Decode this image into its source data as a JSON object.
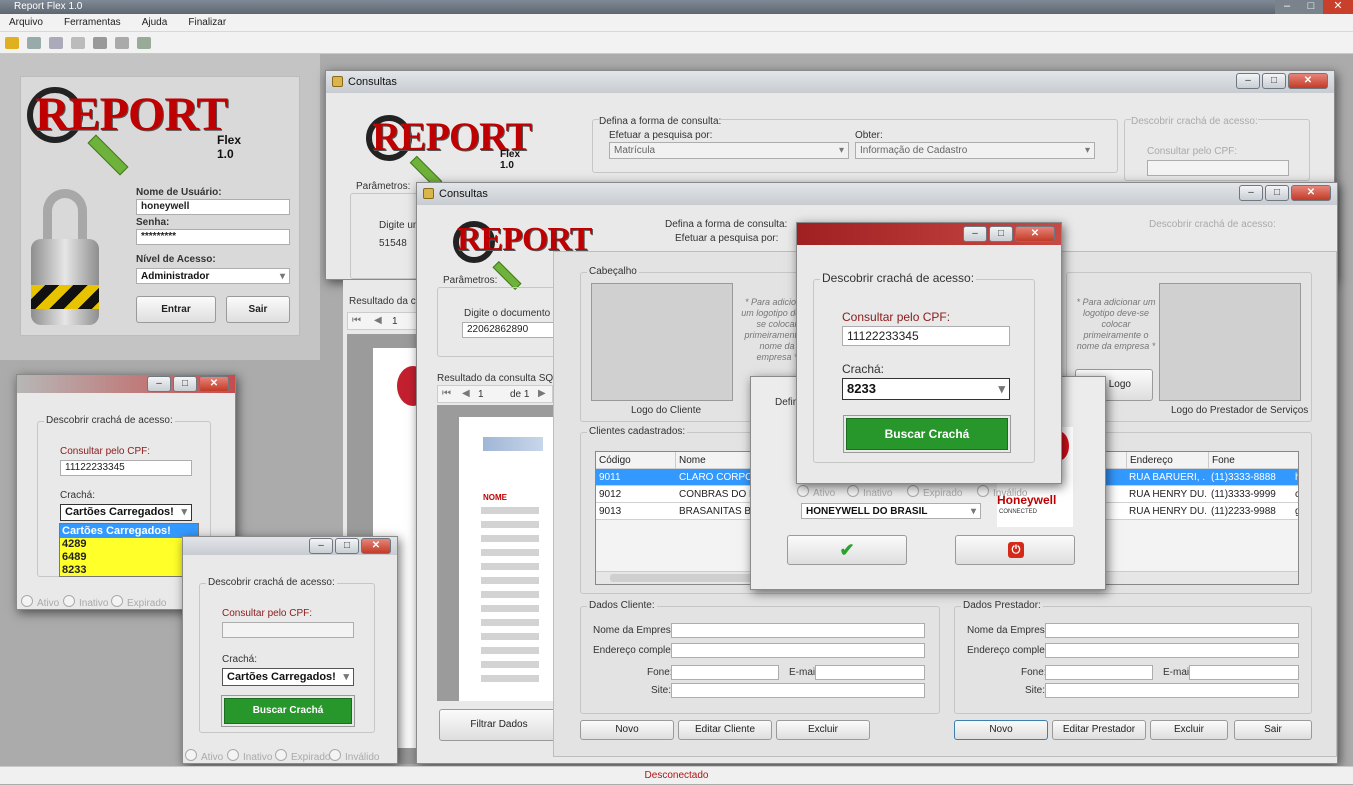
{
  "app": {
    "title": "Report Flex 1.0",
    "menu": [
      "Arquivo",
      "Ferramentas",
      "Ajuda",
      "Finalizar"
    ],
    "status": "Desconectado"
  },
  "login": {
    "logo_text": "REPORT",
    "logo_sub": "Flex 1.0",
    "username_label": "Nome de Usuário:",
    "username": "honeywell",
    "password_label": "Senha:",
    "password": "*********",
    "level_label": "Nível de Acesso:",
    "level": "Administrador",
    "enter": "Entrar",
    "exit": "Sair"
  },
  "badge_small": {
    "group_title": "Descobrir crachá de acesso:",
    "cpf_label": "Consultar pelo CPF:",
    "cpf": "11122233345",
    "cracha_label": "Crachá:",
    "cracha_selected": "Cartões Carregados!",
    "options": [
      "Cartões Carregados!",
      "4289",
      "6489",
      "8233"
    ],
    "status": [
      "Ativo",
      "Inativo",
      "Expirado"
    ]
  },
  "badge_mid": {
    "group_title": "Descobrir crachá de acesso:",
    "cpf_label": "Consultar pelo CPF:",
    "cracha_label": "Crachá:",
    "cracha_selected": "Cartões Carregados!",
    "search": "Buscar Crachá",
    "status": [
      "Ativo",
      "Inativo",
      "Expirado",
      "Inválido"
    ]
  },
  "consultas1": {
    "title": "Consultas",
    "logo_text": "REPORT",
    "logo_sub": "Flex 1.0",
    "form_title": "Defina a forma de consulta:",
    "search_by_label": "Efetuar a pesquisa por:",
    "search_by": "Matrícula",
    "obtain_label": "Obter:",
    "obtain": "Informação de Cadastro",
    "badge_group": "Descobrir crachá de acesso:",
    "cpf_label": "Consultar pelo CPF:",
    "params": "Parâmetros:",
    "digit_label": "Digite um",
    "digit_value": "51548",
    "result": "Resultado da co",
    "page": "1"
  },
  "consultas2": {
    "title": "Consultas",
    "logo_text": "REPORT",
    "form_title": "Defina a forma de consulta:",
    "search_by_label": "Efetuar a pesquisa por:",
    "badge_group": "Descobrir crachá de acesso:",
    "params": "Parâmetros:",
    "digit_label": "Digite o documento do V",
    "digit_value": "22062862890",
    "result": "Resultado da consulta SQL: pe",
    "page": "1",
    "of": "de 1",
    "report_header": "NOME",
    "filter": "Filtrar Dados",
    "co": "CO"
  },
  "clients": {
    "header_group": "Cabeçalho",
    "logo_hint": "* Para adicionar um logotipo deve-se colocar primeiramente o nome da empresa *",
    "client_logo": "Logo do Cliente",
    "provider_logo": "Logo do Prestador de Serviços",
    "add_logo": "ar Logo",
    "clients_group": "Clientes cadastrados:",
    "columns": [
      "Código",
      "Nome"
    ],
    "rows": [
      {
        "code": "9011",
        "name": "CLARO CORPO..."
      },
      {
        "code": "9012",
        "name": "CONBRAS DO B..."
      },
      {
        "code": "9013",
        "name": "BRASANITAS B..."
      }
    ],
    "columns2": [
      "Endereço",
      "Fone"
    ],
    "rows2": [
      {
        "addr": "RUA BARUERI, ...",
        "phone": "(11)3333-8888",
        "extra": "h"
      },
      {
        "addr": "RUA HENRY DU...",
        "phone": "(11)3333-9999",
        "extra": "c"
      },
      {
        "addr": "RUA HENRY DU...",
        "phone": "(11)2233-9988",
        "extra": "g"
      }
    ],
    "client_data": "Dados Cliente:",
    "provider_data": "Dados Prestador:",
    "company": "Nome da Empresa:",
    "address": "Endereço completo:",
    "phone": "Fone:",
    "email": "E-mail:",
    "site": "Site:",
    "new": "Novo",
    "edit_client": "Editar Cliente",
    "delete": "Excluir",
    "new2": "Novo",
    "edit_provider": "Editar Prestador",
    "delete2": "Excluir",
    "exit": "Sair"
  },
  "dialog_small": {
    "defina": "Defina",
    "company": "HONEYWELL DO BRASIL",
    "status": [
      "Ativo",
      "Inativo",
      "Expirado",
      "Inválido"
    ],
    "honeywell": "Honeywell",
    "connected": "CONNECTED"
  },
  "badge_big": {
    "group_title": "Descobrir crachá de acesso:",
    "cpf_label": "Consultar pelo CPF:",
    "cpf": "11122233345",
    "cracha_label": "Crachá:",
    "cracha": "8233",
    "search": "Buscar Crachá"
  }
}
